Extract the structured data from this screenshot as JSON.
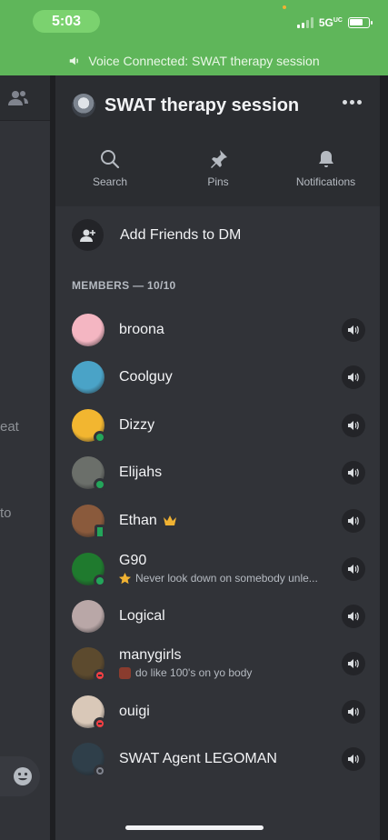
{
  "status_bar": {
    "time": "5:03",
    "network": "5G",
    "network_sup": "UC",
    "battery_level": 0.75
  },
  "voice_banner": {
    "text": "Voice Connected: SWAT therapy session",
    "icon": "speaker-icon"
  },
  "background_fragments": [
    "eat",
    "to"
  ],
  "header": {
    "title": "SWAT therapy session",
    "more_icon": "more-dots-icon",
    "actions": [
      {
        "label": "Search",
        "icon": "search-icon"
      },
      {
        "label": "Pins",
        "icon": "pin-icon"
      },
      {
        "label": "Notifications",
        "icon": "bell-icon"
      }
    ]
  },
  "add_friends": {
    "label": "Add Friends to DM",
    "icon": "add-friend-icon"
  },
  "members": {
    "header": "MEMBERS — 10/10",
    "list": [
      {
        "name": "broona",
        "status": "none",
        "avatar_color": "#f4b6c2"
      },
      {
        "name": "Coolguy",
        "status": "none",
        "avatar_color": "#4aa3c7"
      },
      {
        "name": "Dizzy",
        "status": "online",
        "avatar_color": "#f2b630"
      },
      {
        "name": "Elijahs",
        "status": "online",
        "avatar_color": "#6b6f6a"
      },
      {
        "name": "Ethan",
        "status": "mobile",
        "avatar_color": "#8a5a3c",
        "crown": true
      },
      {
        "name": "G90",
        "status": "online",
        "avatar_color": "#1f7a2e",
        "subtitle": "Never look down on somebody unle...",
        "subtitle_emoji": "star"
      },
      {
        "name": "Logical",
        "status": "none",
        "avatar_color": "#b9a7a7"
      },
      {
        "name": "manygirls",
        "status": "dnd",
        "avatar_color": "#5c4a2e",
        "subtitle": "do like 100's on yo body",
        "subtitle_emoji": "image"
      },
      {
        "name": "ouigi",
        "status": "dnd",
        "avatar_color": "#d9c8b8"
      },
      {
        "name": "SWAT Agent LEGOMAN",
        "status": "offline",
        "avatar_color": "#2f3f4a"
      }
    ]
  },
  "colors": {
    "status_green": "#5fb65a",
    "online": "#23a55a",
    "dnd": "#f23f43",
    "crown": "#f0b232"
  }
}
